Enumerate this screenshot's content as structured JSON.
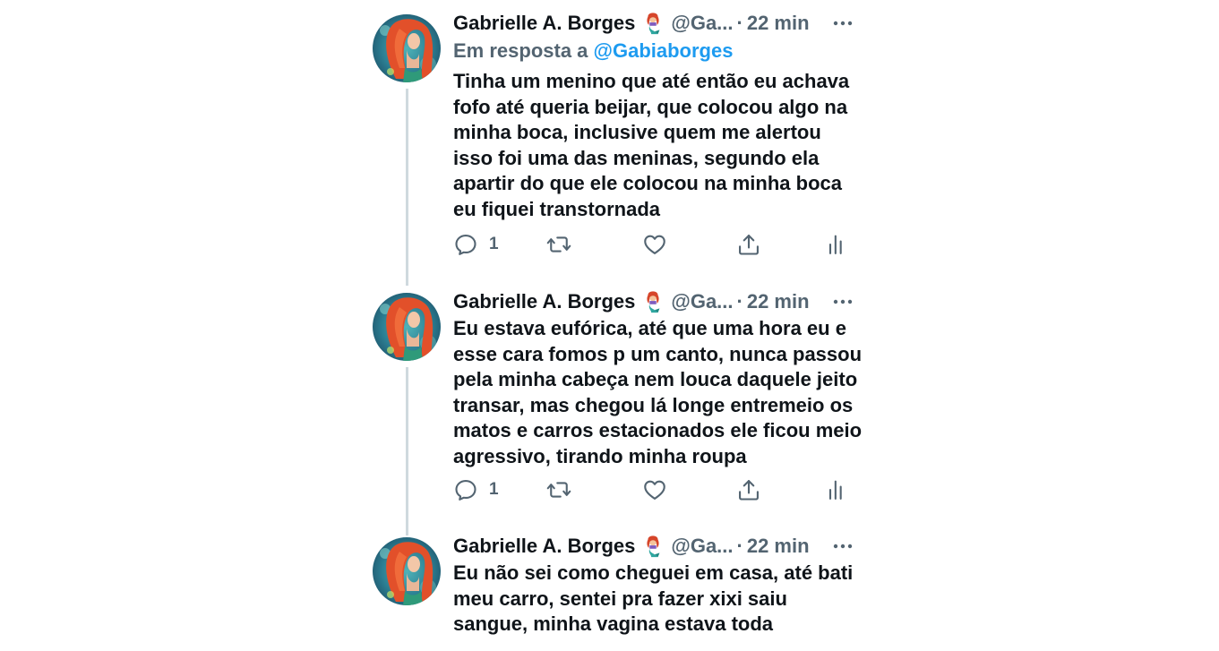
{
  "tweets": [
    {
      "name": "Gabrielle A. Borges",
      "handle": "@Ga...",
      "dot": "·",
      "time": "22 min",
      "reply_prefix": "Em resposta a",
      "reply_mention": "@Gabiaborges",
      "text": "Tinha um menino que até então eu achava fofo até queria beijar, que colocou algo na minha boca, inclusive quem me alertou isso foi uma das meninas, segundo ela apartir do que ele colocou na minha boca eu fiquei transtornada",
      "reply_count": "1"
    },
    {
      "name": "Gabrielle A. Borges",
      "handle": "@Ga...",
      "dot": "·",
      "time": "22 min",
      "text": "Eu estava eufórica, até que uma hora eu e esse cara fomos p um canto, nunca passou pela minha cabeça nem louca daquele jeito transar, mas chegou lá longe entremeio os matos e carros estacionados ele ficou meio agressivo, tirando minha roupa",
      "reply_count": "1"
    },
    {
      "name": "Gabrielle A. Borges",
      "handle": "@Ga...",
      "dot": "·",
      "time": "22 min",
      "text": "Eu não sei como cheguei em casa, até bati meu carro, sentei pra fazer xixi saiu sangue, minha vagina estava toda"
    }
  ],
  "icons": {
    "avatar": "avatar-mermaid-portrait",
    "emoji": "mermaid-emoji",
    "more": "more-options-icon",
    "reply": "reply-icon",
    "retweet": "retweet-icon",
    "like": "like-icon",
    "share": "share-icon",
    "analytics": "analytics-icon"
  },
  "colors": {
    "text": "#0f1419",
    "secondary": "#536471",
    "link": "#1d9bf0",
    "thread_line": "#cfd9de"
  }
}
